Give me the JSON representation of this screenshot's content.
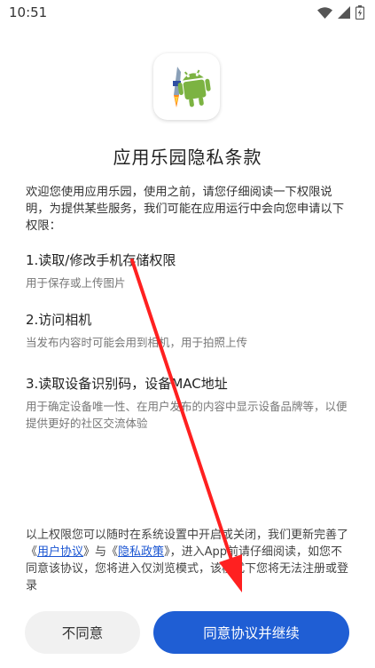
{
  "status_bar": {
    "time": "10:51"
  },
  "dialog": {
    "title": "应用乐园隐私条款",
    "intro": "欢迎您使用应用乐园，使用之前，请您仔细阅读一下权限说明，为提供某些服务，我们可能在应用运行中会向您申请以下权限：",
    "permissions": [
      {
        "title": "1.读取/修改手机存储权限",
        "desc": "用于保存或上传图片"
      },
      {
        "title": "2.访问相机",
        "desc": "当发布内容时可能会用到相机，用于拍照上传"
      },
      {
        "title": "3.读取设备识别码，设备MAC地址",
        "desc": "用于确定设备唯一性、在用户发布的内容中显示设备品牌等，以便提供更好的社区交流体验"
      }
    ],
    "footer": {
      "part1": "以上权限您可以随时在系统设置中开启或关闭，我们更新完善了《",
      "user_agreement": "用户协议",
      "part2": "》与《",
      "privacy_policy": "隐私政策",
      "part3": "》，进入App前请仔细阅读，如您不同意该协议，您将进入仅浏览模式，该模式下您将无法注册或登录"
    },
    "buttons": {
      "disagree": "不同意",
      "agree": "同意协议并继续"
    }
  },
  "colors": {
    "accent": "#1f5ed4",
    "link": "#1a55d2",
    "annotation_arrow": "#ff2020"
  },
  "icons": [
    "wifi-icon",
    "signal-icon",
    "battery-charging-icon",
    "android-robot-icon",
    "rocket-icon"
  ]
}
